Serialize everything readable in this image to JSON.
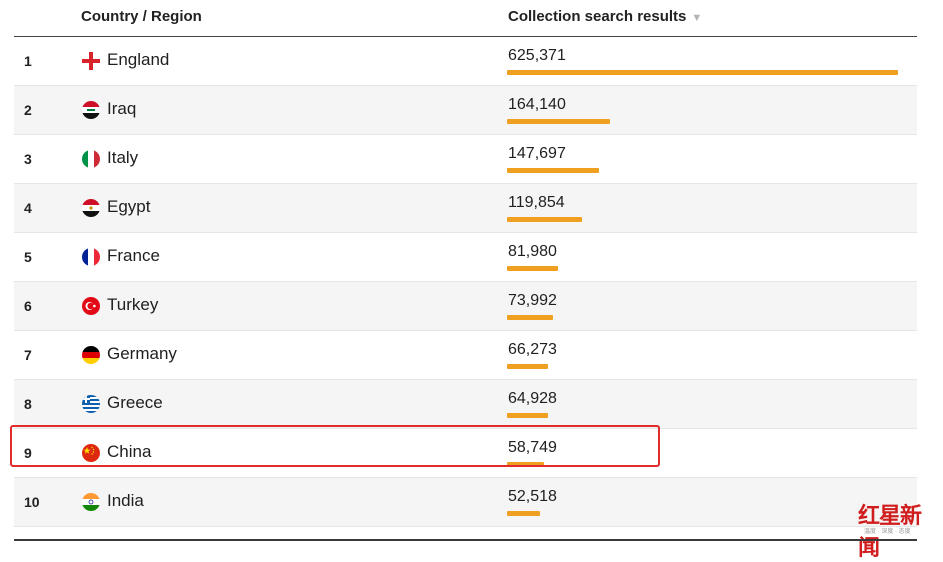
{
  "header": {
    "country_label": "Country / Region",
    "results_label": "Collection search results",
    "sort_icon": "▼"
  },
  "chart_data": {
    "type": "bar",
    "orientation": "horizontal",
    "columns": [
      "Country / Region",
      "Collection search results"
    ],
    "categories": [
      "England",
      "Iraq",
      "Italy",
      "Egypt",
      "France",
      "Turkey",
      "Germany",
      "Greece",
      "China",
      "India"
    ],
    "ranks": [
      "1",
      "2",
      "3",
      "4",
      "5",
      "6",
      "7",
      "8",
      "9",
      "10"
    ],
    "values": [
      625371,
      164140,
      147697,
      119854,
      81980,
      73992,
      66273,
      64928,
      58749,
      52518
    ],
    "value_labels": [
      "625,371",
      "164,140",
      "147,697",
      "119,854",
      "81,980",
      "73,992",
      "66,273",
      "64,928",
      "58,749",
      "52,518"
    ],
    "flag_icons": [
      "england-flag-icon",
      "iraq-flag-icon",
      "italy-flag-icon",
      "egypt-flag-icon",
      "france-flag-icon",
      "turkey-flag-icon",
      "germany-flag-icon",
      "greece-flag-icon",
      "china-flag-icon",
      "india-flag-icon"
    ],
    "highlighted_category": "China",
    "bar_color": "#f0a020",
    "highlight_color": "#e02c2c",
    "xlim": [
      0,
      625371
    ]
  },
  "watermark": {
    "main": "红星新闻",
    "sub": "温度 · 深度 · 态度"
  }
}
